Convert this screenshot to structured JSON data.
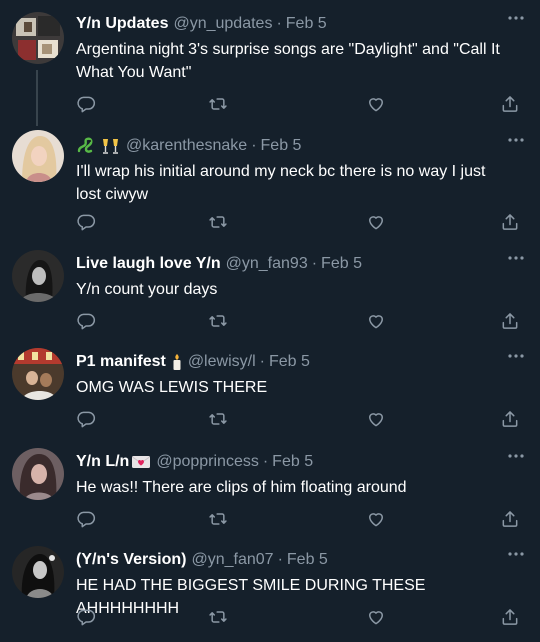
{
  "tweets": [
    {
      "display_name": "Y/n Updates",
      "handle": "@yn_updates",
      "time": "Feb 5",
      "text": "Argentina night 3's surprise songs are \"Daylight\" and \"Call It What You Want\""
    },
    {
      "display_name": "",
      "handle": "@karenthesnake",
      "time": "Feb 5",
      "text": "I'll wrap his initial around my neck bc there is no way I just lost ciwyw"
    },
    {
      "display_name": "Live laugh love Y/n",
      "handle": "@yn_fan93",
      "time": "Feb 5",
      "text": "Y/n count your days"
    },
    {
      "display_name": "P1 manifest",
      "handle": "@lewisy/l",
      "time": "Feb 5",
      "text": "OMG WAS LEWIS THERE"
    },
    {
      "display_name": "Y/n L/n",
      "handle": "@popprincess",
      "time": "Feb 5",
      "text": "He was!! There are clips of him floating around"
    },
    {
      "display_name": "(Y/n's Version)",
      "handle": "@yn_fan07",
      "time": "Feb 5",
      "text": "HE HAD THE BIGGEST SMILE DURING THESE AHHHHHHHH"
    }
  ],
  "dot_separator": "·",
  "icons": {
    "reply": "reply-icon",
    "retweet": "retweet-icon",
    "like": "like-icon",
    "share": "share-icon",
    "more": "more-icon"
  },
  "colors": {
    "background": "#15202b",
    "secondary_text": "#8b98a5",
    "thread_line": "#38444d"
  }
}
